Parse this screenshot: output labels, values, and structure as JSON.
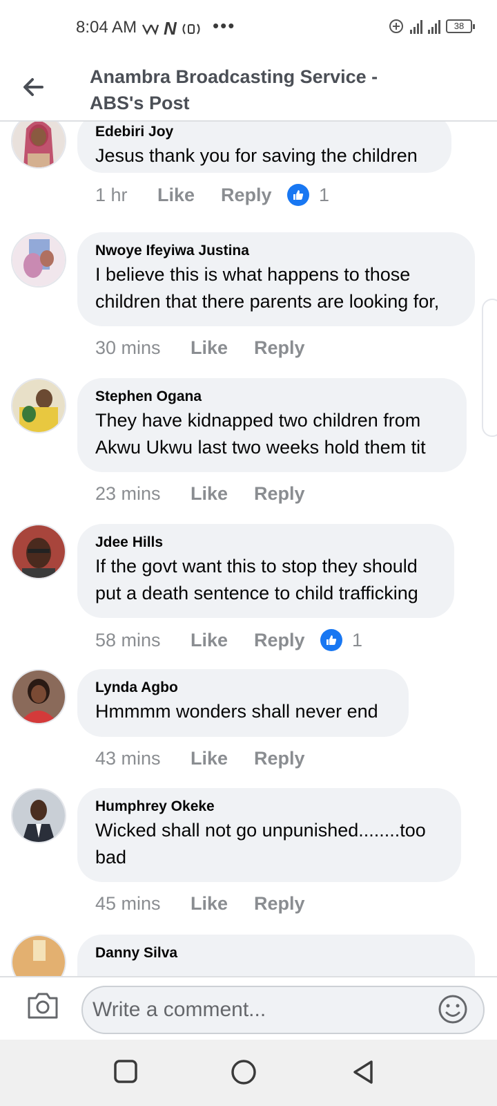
{
  "status_bar": {
    "time": "8:04 AM",
    "network_label": "N",
    "dots": "•••",
    "battery": "38"
  },
  "header": {
    "back_icon": "back-arrow-icon",
    "title": "Anambra Broadcasting Service - ABS's Post"
  },
  "comments": [
    {
      "author": "Edebiri Joy",
      "text": "Jesus thank you for saving the children",
      "time": "1 hr",
      "like": "Like",
      "reply": "Reply",
      "reactions": "1",
      "avatar_color": "#c9a08a"
    },
    {
      "author": "Nwoye Ifeyiwa Justina",
      "text": "I believe this is what happens to those children that there parents are looking for,",
      "time": "30 mins",
      "like": "Like",
      "reply": "Reply",
      "reactions": "",
      "avatar_color": "#d8b7c8"
    },
    {
      "author": "Stephen Ogana",
      "text": "They have kidnapped two children from Akwu Ukwu last two weeks hold them tit",
      "time": "23 mins",
      "like": "Like",
      "reply": "Reply",
      "reactions": "",
      "avatar_color": "#b8a060"
    },
    {
      "author": "Jdee Hills",
      "text": "If the govt want this to stop they should put a death sentence to child trafficking",
      "time": "58 mins",
      "like": "Like",
      "reply": "Reply",
      "reactions": "1",
      "avatar_color": "#8a3a32"
    },
    {
      "author": "Lynda Agbo",
      "text": "Hmmmm wonders shall never end",
      "time": "43 mins",
      "like": "Like",
      "reply": "Reply",
      "reactions": "",
      "avatar_color": "#6e4a3c"
    },
    {
      "author": "Humphrey Okeke",
      "text": "Wicked shall not go unpunished........too bad",
      "time": "45 mins",
      "like": "Like",
      "reply": "Reply",
      "reactions": "",
      "avatar_color": "#9aa6b2"
    },
    {
      "author": "Danny Silva",
      "text": "",
      "time": "",
      "like": "",
      "reply": "",
      "reactions": "",
      "avatar_color": "#d9a060"
    }
  ],
  "composer": {
    "placeholder": "Write a comment...",
    "camera_icon": "camera-icon",
    "emoji_icon": "emoji-icon"
  },
  "navbar": {
    "recents_icon": "square-recents-icon",
    "home_icon": "circle-home-icon",
    "back_icon": "triangle-back-icon"
  },
  "colors": {
    "accent": "#1877f2",
    "bubble": "#f0f2f5",
    "meta": "#8a8d91"
  }
}
